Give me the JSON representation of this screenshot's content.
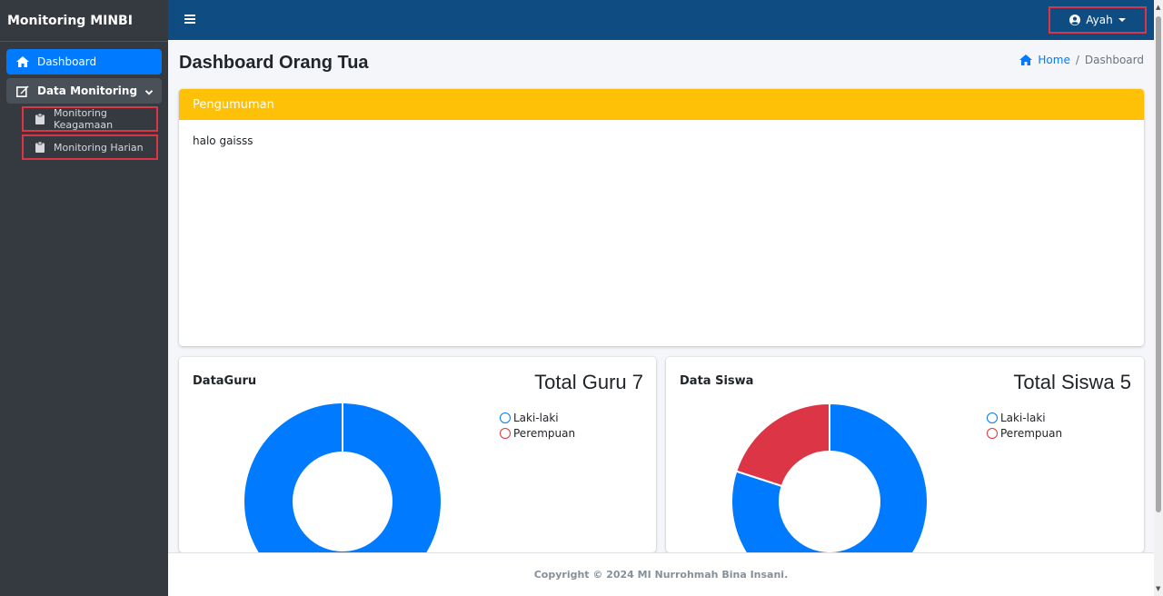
{
  "sidebar": {
    "brand": "Monitoring MINBI",
    "items": [
      {
        "label": "Dashboard",
        "icon": "home-icon",
        "active": true
      },
      {
        "label": "Data Monitoring",
        "icon": "edit-icon",
        "expanded": true
      }
    ],
    "subitems": [
      {
        "label": "Monitoring Keagamaan",
        "icon": "clipboard-icon"
      },
      {
        "label": "Monitoring Harian",
        "icon": "clipboard-icon"
      }
    ]
  },
  "topbar": {
    "user": "Ayah",
    "menu_icon": "hamburger-icon",
    "user_icon": "user-circle-icon"
  },
  "page": {
    "title": "Dashboard Orang Tua",
    "breadcrumb": [
      "Home",
      "Dashboard"
    ]
  },
  "announcement": {
    "title": "Pengumuman",
    "text": "halo gaisss"
  },
  "cards": {
    "guru": {
      "title": "DataGuru",
      "total": "Total Guru 7"
    },
    "siswa": {
      "title": "Data Siswa",
      "total": "Total Siswa 5"
    }
  },
  "chart_data": [
    {
      "type": "pie",
      "categories": [
        "Laki-laki",
        "Perempuan"
      ],
      "values": [
        7,
        0
      ],
      "colors": [
        "#007bff",
        "#dc3545"
      ],
      "title": "DataGuru",
      "legend": "top-right"
    },
    {
      "type": "pie",
      "categories": [
        "Laki-laki",
        "Perempuan"
      ],
      "values": [
        4,
        1
      ],
      "colors": [
        "#007bff",
        "#dc3545"
      ],
      "title": "Data Siswa",
      "legend": "top-right"
    }
  ],
  "footer": {
    "text": "Copyright © 2024 MI Nurrohmah Bina Insani."
  },
  "colors": {
    "topbar": "#0f4c81",
    "sidebar": "#343a40",
    "accent": "#007bff",
    "warning": "#ffc107",
    "danger": "#dc3545"
  }
}
